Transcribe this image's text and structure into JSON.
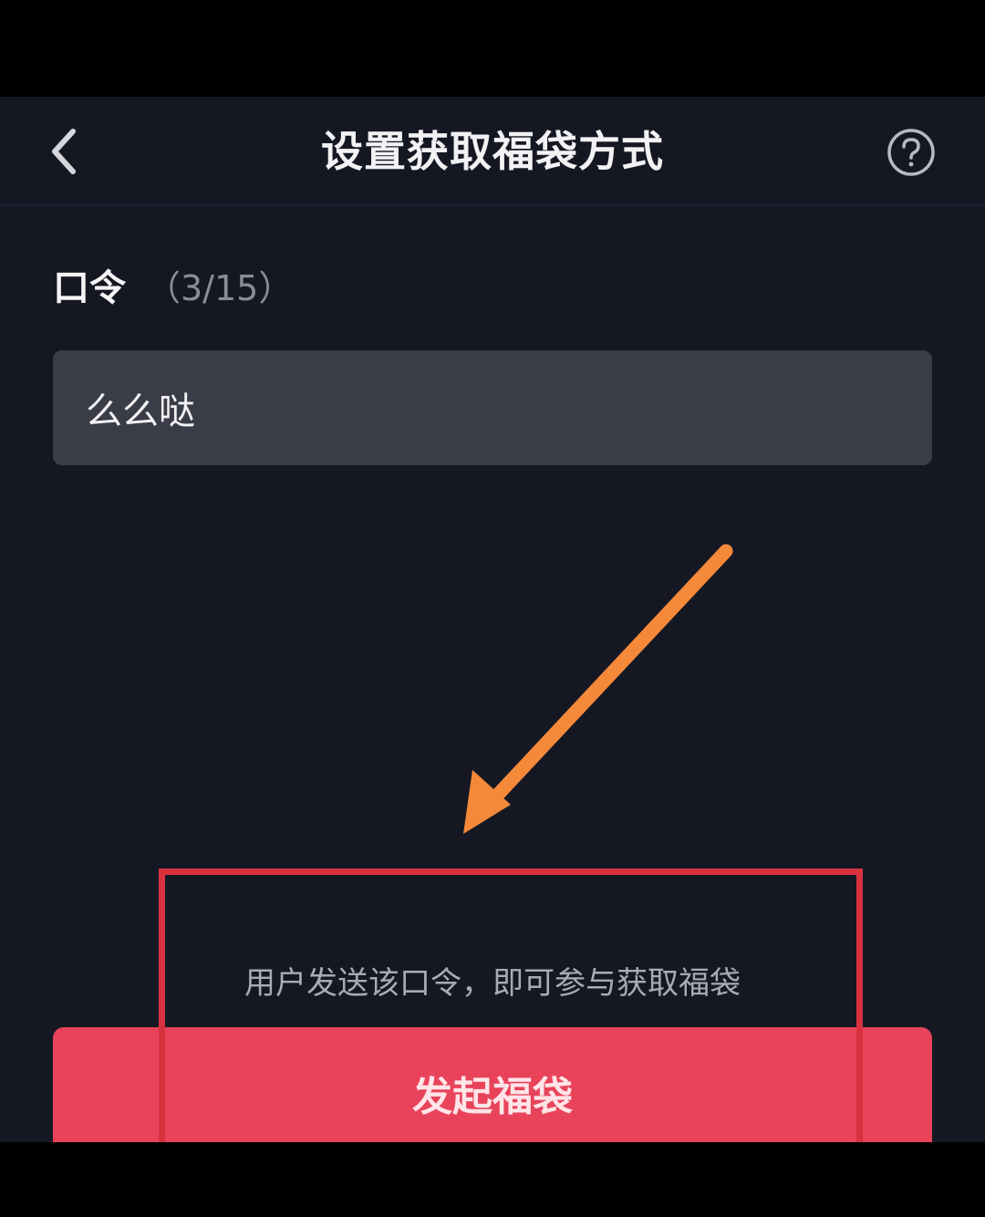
{
  "nav": {
    "back_icon": "chevron-left-icon",
    "title": "设置获取福袋方式",
    "help_icon": "question-circle-icon"
  },
  "field": {
    "label": "口令",
    "count": "（3/15）",
    "value": "么么哒"
  },
  "hint": "用户发送该口令，即可参与获取福袋",
  "submit": {
    "label": "发起福袋"
  },
  "colors": {
    "background": "#151823",
    "input": "#3a3c47",
    "submit": "#e8435a",
    "annotation_arrow": "#f5893a",
    "annotation_frame": "#d8323f"
  }
}
